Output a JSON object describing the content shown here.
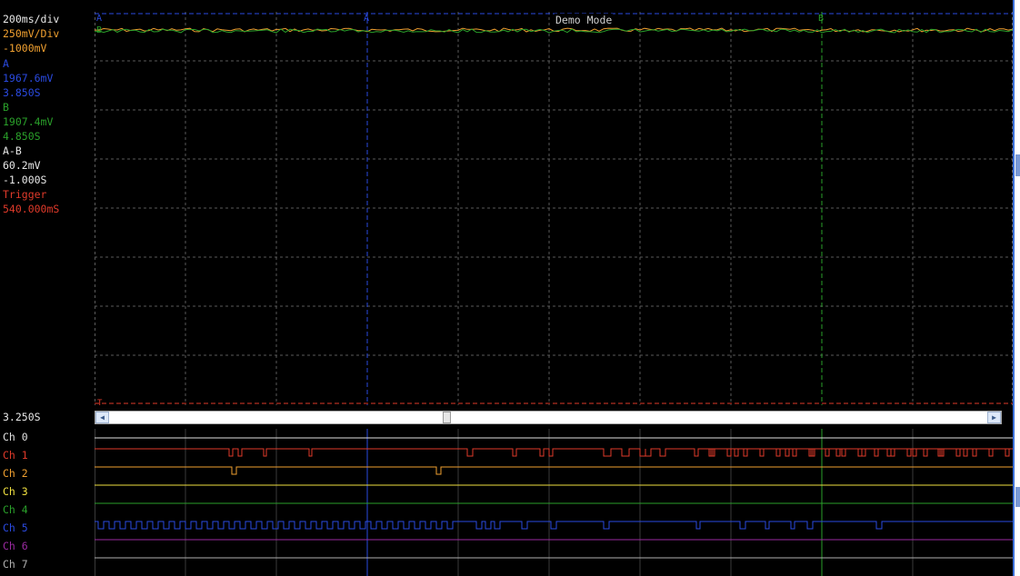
{
  "readouts": {
    "time_div": "200ms/div",
    "volt_div": "250mV/Div",
    "offset": "-1000mV",
    "cursor_a_label": "A",
    "cursor_a_volt": "1967.6mV",
    "cursor_a_time": "3.850S",
    "cursor_b_label": "B",
    "cursor_b_volt": "1907.4mV",
    "cursor_b_time": "4.850S",
    "delta_label": "A-B",
    "delta_volt": "60.2mV",
    "delta_time": "-1.000S",
    "trigger_label": "Trigger",
    "trigger_time": "540.000mS"
  },
  "scope": {
    "mode_title": "Demo Mode",
    "cursor_a_marker": "A",
    "cursor_b_marker": "B",
    "trace_b_marker": "B",
    "trigger_marker": "T",
    "cursor_time": "3.250S"
  },
  "channels": [
    {
      "label": "Ch 0",
      "color": "#e0e0e0"
    },
    {
      "label": "Ch 1",
      "color": "#e03a2a"
    },
    {
      "label": "Ch 2",
      "color": "#f0a030"
    },
    {
      "label": "Ch 3",
      "color": "#f0e040"
    },
    {
      "label": "Ch 4",
      "color": "#2aa02a"
    },
    {
      "label": "Ch 5",
      "color": "#2a4ae0"
    },
    {
      "label": "Ch 6",
      "color": "#9a2aa0"
    },
    {
      "label": "Ch 7",
      "color": "#b0b0b0"
    }
  ],
  "colors": {
    "background": "#000000",
    "grid": "#5a5a5a",
    "cursor_a": "#2a4ae0",
    "cursor_b": "#2aa02a",
    "trigger": "#e03a2a",
    "time_div": "#e8e8e8",
    "volt_div": "#f0a030",
    "offset": "#f0a030",
    "trace_a": "#f0a030",
    "trace_b": "#2aa02a"
  },
  "icons": {
    "scroll_left": "triangle-left-icon",
    "scroll_right": "triangle-right-icon"
  }
}
